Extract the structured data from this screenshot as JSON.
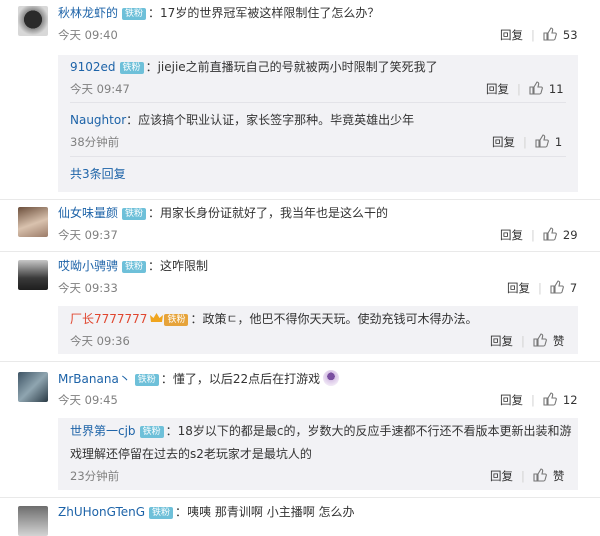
{
  "reply_label": "回复",
  "comments": [
    {
      "user": "秋林龙虾的",
      "badge": "铁粉",
      "sep": "：",
      "text": "17岁的世界冠军被这样限制住了怎么办？",
      "time": "今天 09:40",
      "likes": "53",
      "replies": [
        {
          "user": "9102ed",
          "badge": "铁粉",
          "text": "：jiejie之前直播玩自己的号就被两小时限制了笑死我了",
          "time": "今天 09:47",
          "likes": "11"
        },
        {
          "user": "Naughtor",
          "text": "：应该搞个职业认证，家长签字那种。毕竟英雄出少年",
          "time": "38分钟前",
          "likes": "1"
        }
      ],
      "more": "共3条回复"
    },
    {
      "user": "仙女味量颜",
      "badge": "铁粉",
      "sep": "：",
      "text": "用家长身份证就好了，我当年也是这么干的",
      "time": "今天 09:37",
      "likes": "29"
    },
    {
      "user": "哎呦小骋骋",
      "badge": "铁粉",
      "sep": "：",
      "text": "这咋限制",
      "time": "今天 09:33",
      "likes": "7",
      "replies": [
        {
          "user": "厂长7777777",
          "badge": "铁粉",
          "text": "：政策ㄷ，他巴不得你天天玩。使劲充钱可木得办法。",
          "time": "今天 09:36",
          "likes": "赞"
        }
      ]
    },
    {
      "user": "MrBanana丶",
      "badge": "铁粉",
      "sep": "：",
      "text": "懂了，以后22点后在打游戏",
      "time": "今天 09:45",
      "likes": "12",
      "replies": [
        {
          "user": "世界第一cjb",
          "badge": "铁粉",
          "text": "：18岁以下的都是最c的，岁数大的反应手速都不行还不看版本更新出装和游",
          "text2": "戏理解还停留在过去的s2老玩家才是最坑人的",
          "time": "23分钟前",
          "likes": "赞"
        }
      ]
    },
    {
      "user": "ZhUHonGTenG",
      "badge": "铁粉",
      "sep": "：",
      "text": "咦咦 那青训啊 小主播啊 怎么办"
    }
  ]
}
